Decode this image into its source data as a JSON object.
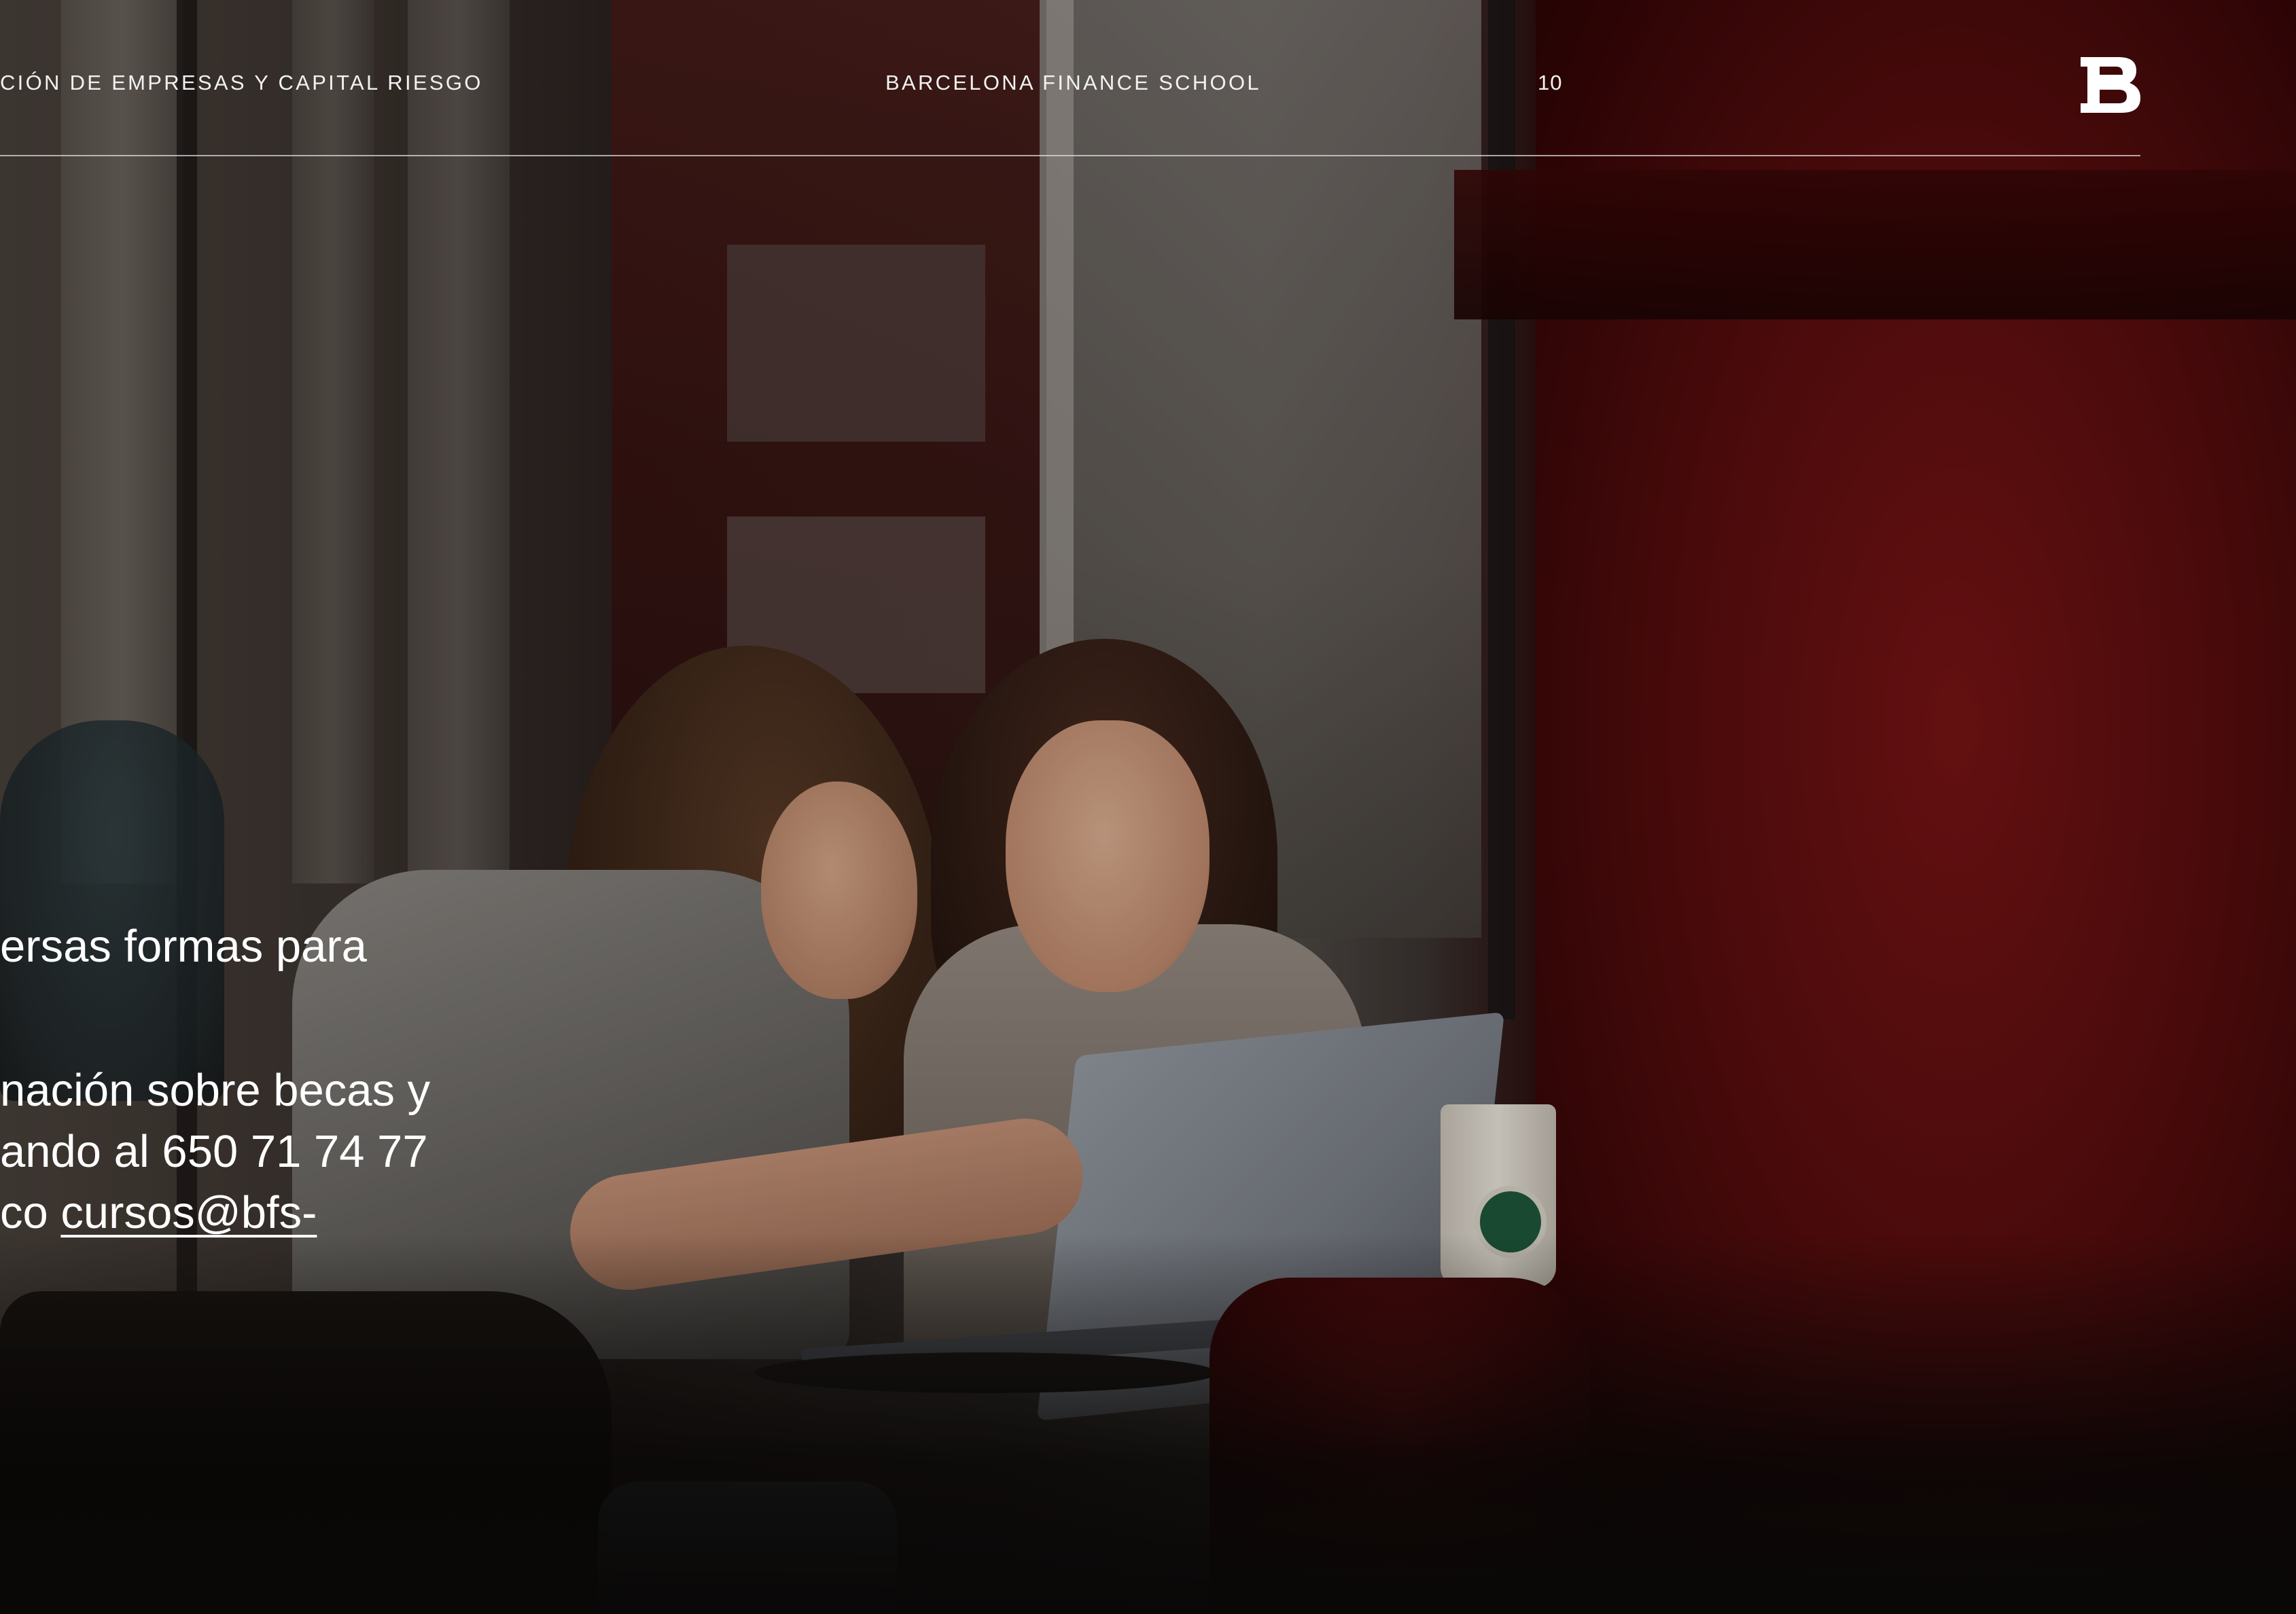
{
  "header": {
    "section_title": "CIÓN DE EMPRESAS Y CAPITAL RIESGO",
    "school_name": "BARCELONA FINANCE SCHOOL",
    "page_number": "10"
  },
  "body": {
    "line1": "ersas formas para",
    "line2": "nación sobre becas y",
    "line3": "ando al 650 71 74 77",
    "line4_prefix": "co ",
    "line4_email": "cursos@bfs-"
  },
  "logo": {
    "icon": "bfs-monogram-logo"
  },
  "colors": {
    "text": "#ffffff",
    "accent_red": "#6a0f10"
  }
}
